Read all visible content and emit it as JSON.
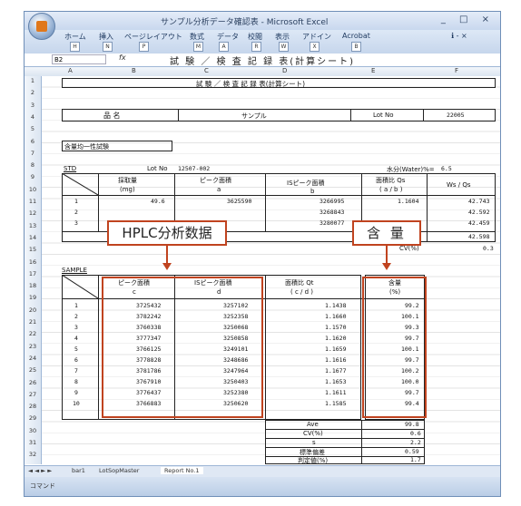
{
  "window": {
    "title": "サンプル分析データ確認表 - Microsoft Excel",
    "controls": "_ □ ×"
  },
  "ribbon": {
    "tabs": [
      "ホーム",
      "挿入",
      "ページレイアウト",
      "数式",
      "データ",
      "校閲",
      "表示",
      "アドイン",
      "Acrobat"
    ],
    "help": "ℹ - ×",
    "keytips": [
      "H",
      "N",
      "P",
      "M",
      "A",
      "R",
      "W",
      "X",
      "B"
    ]
  },
  "formula_bar": {
    "name_box": "B2",
    "fx": "fx",
    "value": "試 験 ／ 検 査 記 録 表(計算シート)"
  },
  "columns": [
    "A",
    "B",
    "C",
    "D",
    "E",
    "F"
  ],
  "rows": [
    "1",
    "2",
    "3",
    "4",
    "5",
    "6",
    "7",
    "8",
    "9",
    "10",
    "11",
    "12",
    "13",
    "14",
    "15",
    "16",
    "17",
    "18",
    "19",
    "20",
    "21",
    "22",
    "23",
    "24",
    "25",
    "26",
    "27",
    "28",
    "29",
    "30",
    "31",
    "32"
  ],
  "sheet": {
    "header_title": "試 験 ／ 検 査 記 録 表(計算シート)",
    "product_label": "品 名",
    "product_value": "サンプル",
    "lot_label": "Lot No",
    "lot_value": "22005",
    "test_name": "含量均一性試験",
    "std": {
      "label": "STD",
      "lot_label": "Lot No",
      "lot_value": "12507-002",
      "water_label": "水分(Water)%=",
      "water_value": "6.5",
      "col_weight": "採取量",
      "col_weight_unit": "(mg)",
      "col_peak": "ピーク面積",
      "col_peak_sub": "a",
      "col_is": "ISピーク面積",
      "col_is_sub": "b",
      "col_ratio": "面積比 Qs",
      "col_ratio_sub": "( a / b )",
      "col_wsqs": "Ws / Qs",
      "rows": [
        {
          "no": "1",
          "weight": "49.6",
          "peak": "3625590",
          "is": "3266995",
          "ratio": "1.1604",
          "wsqs": "42.743"
        },
        {
          "no": "2",
          "weight": "",
          "peak": "",
          "is": "3268843",
          "ratio": "",
          "wsqs": "42.592"
        },
        {
          "no": "3",
          "weight": "",
          "peak": "",
          "is": "3280077",
          "ratio": "",
          "wsqs": "42.459"
        }
      ],
      "avg_wsqs": "42.598",
      "cv_label": "CV(%)",
      "cv_value": "0.3"
    },
    "sample": {
      "label": "SAMPLE",
      "col_peak": "ピーク面積",
      "col_peak_sub": "c",
      "col_is": "ISピーク面積",
      "col_is_sub": "d",
      "col_ratio": "面積比 Qt",
      "col_ratio_sub": "( c / d )",
      "col_content": "含量",
      "col_content_unit": "(%)",
      "rows": [
        {
          "no": "1",
          "peak": "3725432",
          "is": "3257102",
          "ratio": "1.1438",
          "content": "99.2"
        },
        {
          "no": "2",
          "peak": "3782242",
          "is": "3252358",
          "ratio": "1.1660",
          "content": "100.1"
        },
        {
          "no": "3",
          "peak": "3760338",
          "is": "3250068",
          "ratio": "1.1570",
          "content": "99.3"
        },
        {
          "no": "4",
          "peak": "3777347",
          "is": "3250858",
          "ratio": "1.1620",
          "content": "99.7"
        },
        {
          "no": "5",
          "peak": "3766125",
          "is": "3249101",
          "ratio": "1.1659",
          "content": "100.1"
        },
        {
          "no": "6",
          "peak": "3778828",
          "is": "3248686",
          "ratio": "1.1616",
          "content": "99.7"
        },
        {
          "no": "7",
          "peak": "3781786",
          "is": "3247964",
          "ratio": "1.1677",
          "content": "100.2"
        },
        {
          "no": "8",
          "peak": "3767910",
          "is": "3250403",
          "ratio": "1.1653",
          "content": "100.0"
        },
        {
          "no": "9",
          "peak": "3776437",
          "is": "3252380",
          "ratio": "1.1611",
          "content": "99.7"
        },
        {
          "no": "10",
          "peak": "3766883",
          "is": "3250620",
          "ratio": "1.1585",
          "content": "99.4"
        }
      ],
      "stats": [
        {
          "label": "Ave",
          "value": "99.8"
        },
        {
          "label": "CV(%)",
          "value": "0.6"
        },
        {
          "label": "s",
          "value": "2.2"
        },
        {
          "label": "標準偏差",
          "value": "0.59"
        },
        {
          "label": "判定値(%)",
          "value": "1.7"
        }
      ]
    }
  },
  "annotations": {
    "hplc_label": "HPLC分析数据",
    "content_label": "含 量"
  },
  "sheet_tabs": {
    "nav": "◄ ◄ ► ►",
    "tabs": [
      "bar1",
      "LotSopMaster",
      "Report No.1"
    ]
  },
  "status": {
    "text": "コマンド"
  },
  "colors": {
    "highlight": "#c0431f",
    "frame": "#6f8fb8"
  }
}
